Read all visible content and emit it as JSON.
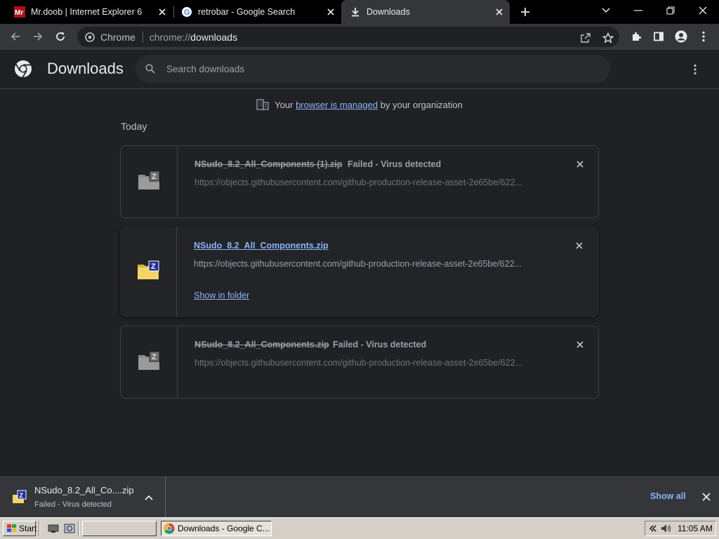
{
  "tabs": [
    {
      "title": "Mr.doob | Internet Explorer 6",
      "favicon": "mrdoob-favicon"
    },
    {
      "title": "retrobar - Google Search",
      "favicon": "google-g-icon"
    },
    {
      "title": "Downloads",
      "favicon": "download-icon",
      "active": true
    }
  ],
  "toolbar": {
    "chip": "Chrome",
    "url_scheme": "chrome://",
    "url_host": "downloads"
  },
  "header": {
    "title": "Downloads",
    "search_placeholder": "Search downloads"
  },
  "managed": {
    "prefix": "Your",
    "link": "browser is managed",
    "suffix": "by your organization"
  },
  "section_label": "Today",
  "downloads": [
    {
      "filename": "NSudo_8.2_All_Components (1).zip",
      "status": "Failed - Virus detected",
      "url": "https://objects.githubusercontent.com/github-production-release-asset-2e65be/622...",
      "state": "failed"
    },
    {
      "filename": "NSudo_8.2_All_Components.zip",
      "status": "",
      "url": "https://objects.githubusercontent.com/github-production-release-asset-2e65be/622...",
      "action": "Show in folder",
      "state": "complete"
    },
    {
      "filename": "NSudo_8.2_All_Components.zip",
      "status": "Failed - Virus detected",
      "url": "https://objects.githubusercontent.com/github-production-release-asset-2e65be/622...",
      "state": "failed"
    }
  ],
  "shelf": {
    "filename": "NSudo_8.2_All_Co....zip",
    "status": "Failed - Virus detected",
    "show_all": "Show all"
  },
  "taskbar": {
    "start_label": "Start",
    "task_label": "Downloads - Google C...",
    "clock": "11:05 AM"
  },
  "colors": {
    "accent": "#8ab4f8",
    "background": "#202124",
    "toolbar": "#35363a"
  }
}
